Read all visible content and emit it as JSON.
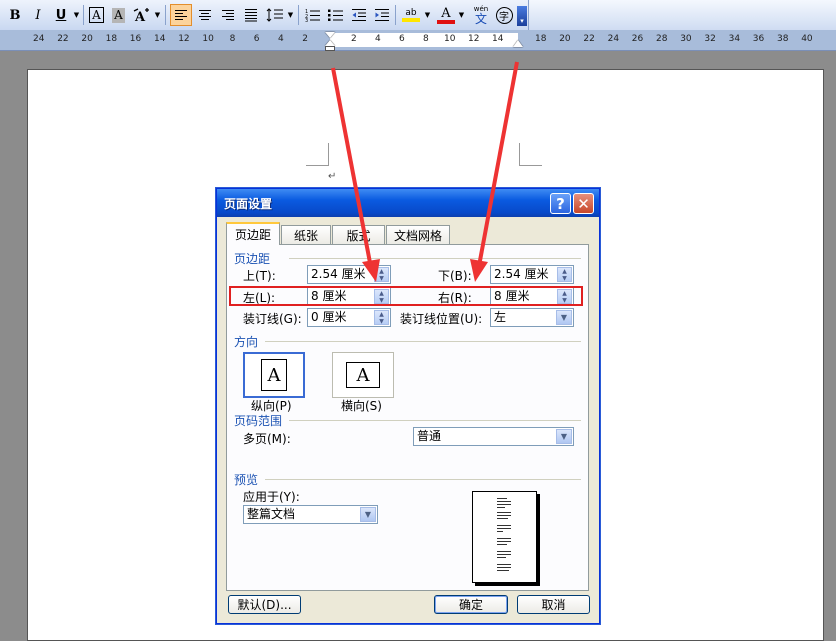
{
  "toolbar": {
    "items": [
      "B",
      "I",
      "U",
      "A",
      "A",
      "ab",
      "A",
      "wén",
      "字"
    ],
    "icons": [
      "bold-icon",
      "italic-icon",
      "underline-icon",
      "char-border-icon",
      "char-shading-icon",
      "char-scale-icon",
      "align-left-icon",
      "align-center-icon",
      "align-right-icon",
      "justify-icon",
      "line-spacing-icon",
      "numbering-icon",
      "bullets-icon",
      "decrease-indent-icon",
      "increase-indent-icon",
      "highlight-icon",
      "font-color-icon",
      "phonetic-guide-icon",
      "enclose-char-icon"
    ],
    "highlight_color": "#ffe600",
    "font_color": "#e01010"
  },
  "ruler": {
    "left_numbers": [
      "24",
      "22",
      "20",
      "18",
      "16",
      "14",
      "12",
      "10",
      "8",
      "6",
      "4",
      "2"
    ],
    "mid_numbers": [
      "2",
      "4",
      "6",
      "8",
      "10",
      "12",
      "14"
    ],
    "right_numbers": [
      "18",
      "20",
      "22",
      "24",
      "26",
      "28",
      "30",
      "32",
      "34",
      "36",
      "38",
      "40"
    ]
  },
  "page": {
    "paragraph_mark": "↵"
  },
  "dialog": {
    "title": "页面设置",
    "help": "?",
    "close": "✕",
    "tabs": [
      "页边距",
      "纸张",
      "版式",
      "文档网格"
    ],
    "margins_section": "页边距",
    "top_label": "上(T):",
    "top_value": "2.54 厘米",
    "bottom_label": "下(B):",
    "bottom_value": "2.54 厘米",
    "left_label": "左(L):",
    "left_value": "8 厘米",
    "right_label": "右(R):",
    "right_value": "8 厘米",
    "gutter_label": "装订线(G):",
    "gutter_value": "0 厘米",
    "gutter_pos_label": "装订线位置(U):",
    "gutter_pos_value": "左",
    "orientation_section": "方向",
    "portrait_label": "纵向(P)",
    "landscape_label": "横向(S)",
    "orientation_glyph": "A",
    "pages_section": "页码范围",
    "multiple_pages_label": "多页(M):",
    "multiple_pages_value": "普通",
    "preview_section": "预览",
    "apply_to_label": "应用于(Y):",
    "apply_to_value": "整篇文档",
    "default_button": "默认(D)...",
    "ok_button": "确定",
    "cancel_button": "取消"
  },
  "annotation": {
    "box_color": "#e02020",
    "arrow_color": "#ee3333"
  }
}
